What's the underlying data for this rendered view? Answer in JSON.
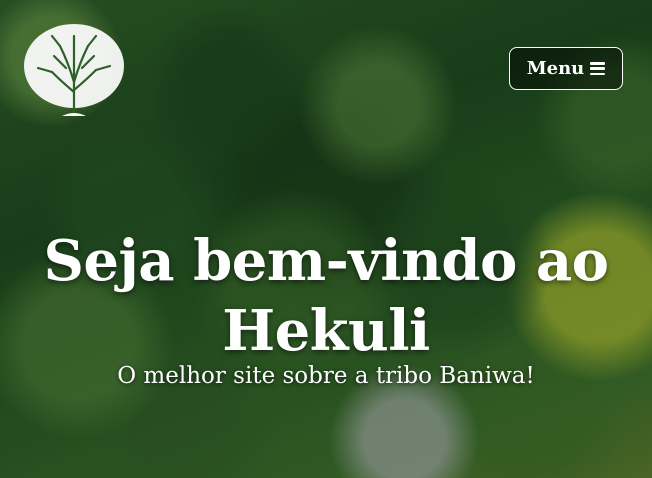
{
  "header": {
    "logo_icon": "tree-icon",
    "menu": {
      "label": "Menu",
      "icon": "hamburger-icon"
    }
  },
  "hero": {
    "title_line1": "Seja bem-vindo ao",
    "title_line2": "Hekuli",
    "subtitle": "O melhor site sobre a tribo Baniwa!"
  },
  "colors": {
    "text": "#ffffff",
    "forest_dark": "#1f4a1f",
    "forest_light": "#5a7a2e"
  }
}
